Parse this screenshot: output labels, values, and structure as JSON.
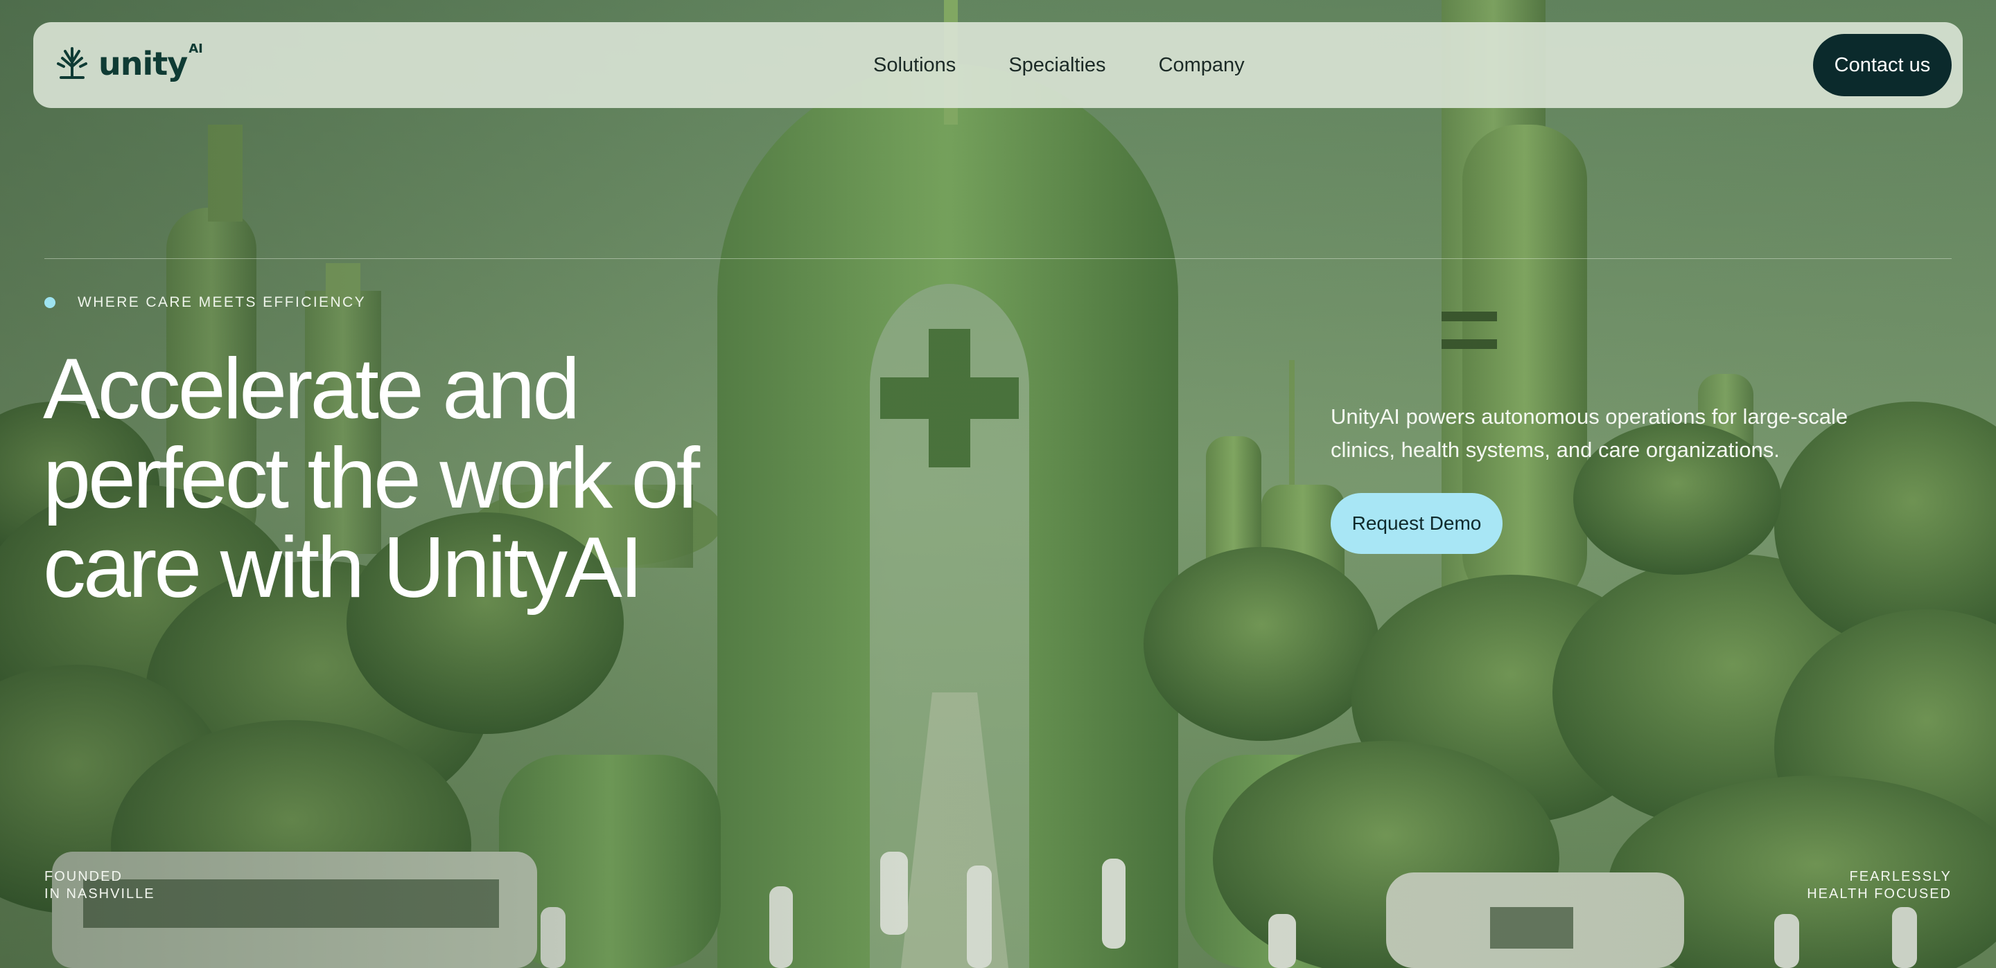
{
  "brand": {
    "name": "unity",
    "superscript": "AI",
    "colors": {
      "primary": "#0f3b34",
      "accent": "#a8e6f5",
      "dark_button": "#0b2a2c"
    }
  },
  "nav": {
    "links": [
      "Solutions",
      "Specialties",
      "Company"
    ],
    "contact_label": "Contact us"
  },
  "hero": {
    "eyebrow": "WHERE CARE MEETS EFFICIENCY",
    "headline_lines": [
      "Accelerate and",
      "perfect the work of",
      "care with UnityAI"
    ],
    "subtext": "UnityAI powers autonomous operations for large-scale clinics, health systems, and care organizations.",
    "cta_label": "Request Demo"
  },
  "footer_notes": {
    "left": [
      "FOUNDED",
      "IN NASHVILLE"
    ],
    "right": [
      "FEARLESSLY",
      "HEALTH FOCUSED"
    ]
  },
  "icons": {
    "logo": "tree-logo-icon",
    "eyebrow": "dot-icon"
  }
}
